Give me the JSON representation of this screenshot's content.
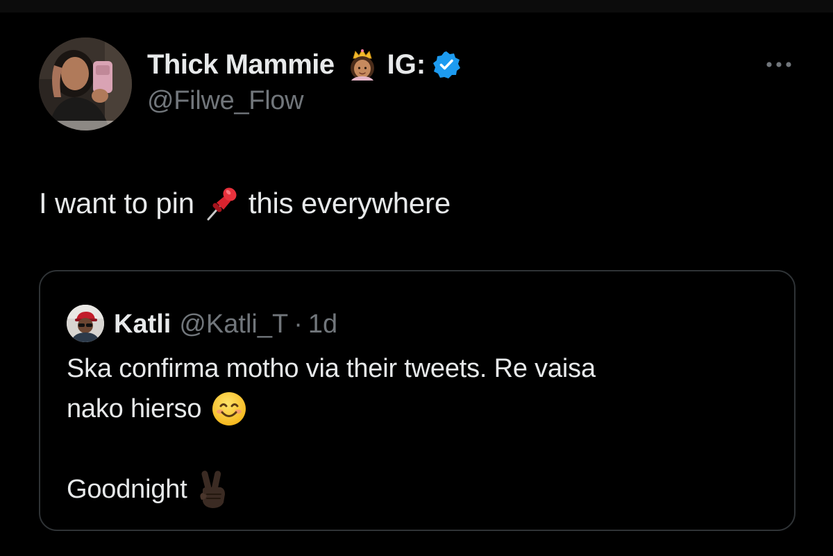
{
  "tweet": {
    "author": {
      "display_name": "Thick Mammie",
      "name_suffix": "IG:",
      "handle": "@Filwe_Flow",
      "verified": true,
      "name_emoji": "princess-crown-icon"
    },
    "text_before": "I want to pin",
    "text_emoji": "pushpin-icon",
    "text_after": "this everywhere",
    "more_icon": "more-options-icon"
  },
  "quote": {
    "author": {
      "display_name": "Katli",
      "handle": "@Katli_T",
      "separator": "·",
      "timestamp": "1d"
    },
    "line1": "Ska confirma motho via their tweets. Re vaisa",
    "line2": "nako hierso",
    "line2_emoji": "smiling-face-icon",
    "line3": "Goodnight",
    "line3_emoji": "victory-hand-icon"
  },
  "colors": {
    "background": "#000000",
    "text_primary": "#e7e9ea",
    "text_secondary": "#71767b",
    "border": "#2f3336",
    "verified_blue": "#1d9bf0"
  }
}
